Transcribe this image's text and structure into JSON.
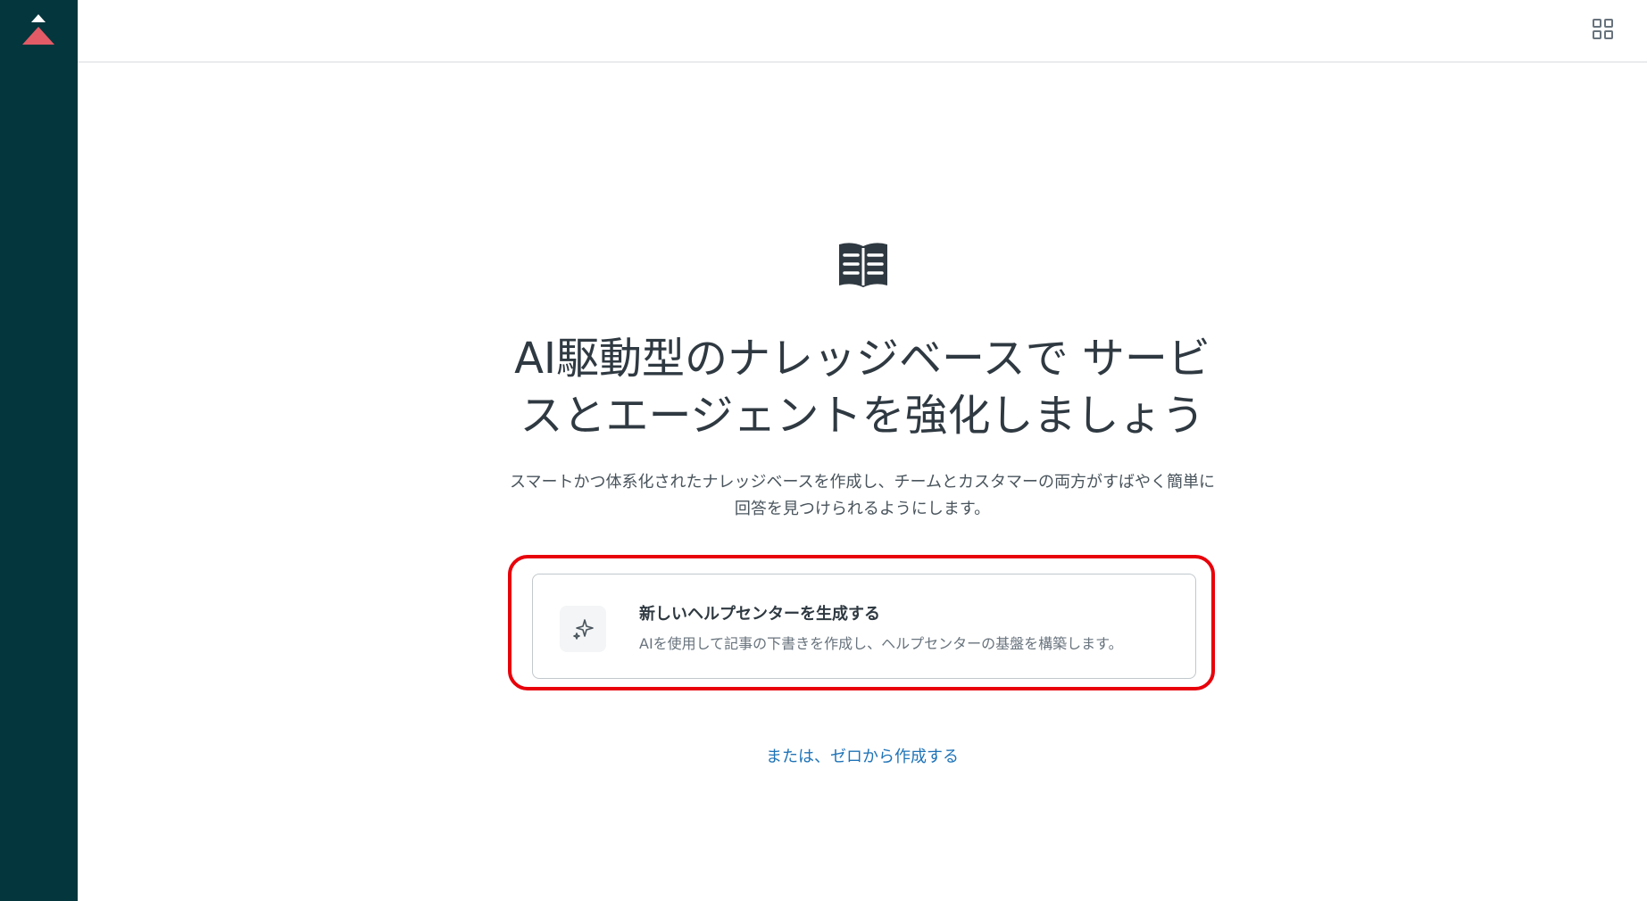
{
  "app": {
    "brand_color": "#03363d",
    "accent_color": "#1f73b7",
    "logo_color": "#e35b66"
  },
  "header": {
    "apps_icon": "grid-icon",
    "avatar_icon": "user-avatar-icon"
  },
  "main": {
    "icon": "book-open-icon",
    "headline_line1": "AI駆動型のナレッジベースで サービ",
    "headline_line2": "スとエージェントを強化しましょう",
    "subtext_line1": "スマートかつ体系化されたナレッジベースを作成し、チームとカスタマーの両方がすばやく簡単に",
    "subtext_line2": "回答を見つけられるようにします。",
    "option": {
      "icon": "sparkle-icon",
      "title": "新しいヘルプセンターを生成する",
      "description": "AIを使用して記事の下書きを作成し、ヘルプセンターの基盤を構築します。"
    },
    "scratch_link": "または、ゼロから作成する",
    "highlight_color": "#e8000b"
  }
}
